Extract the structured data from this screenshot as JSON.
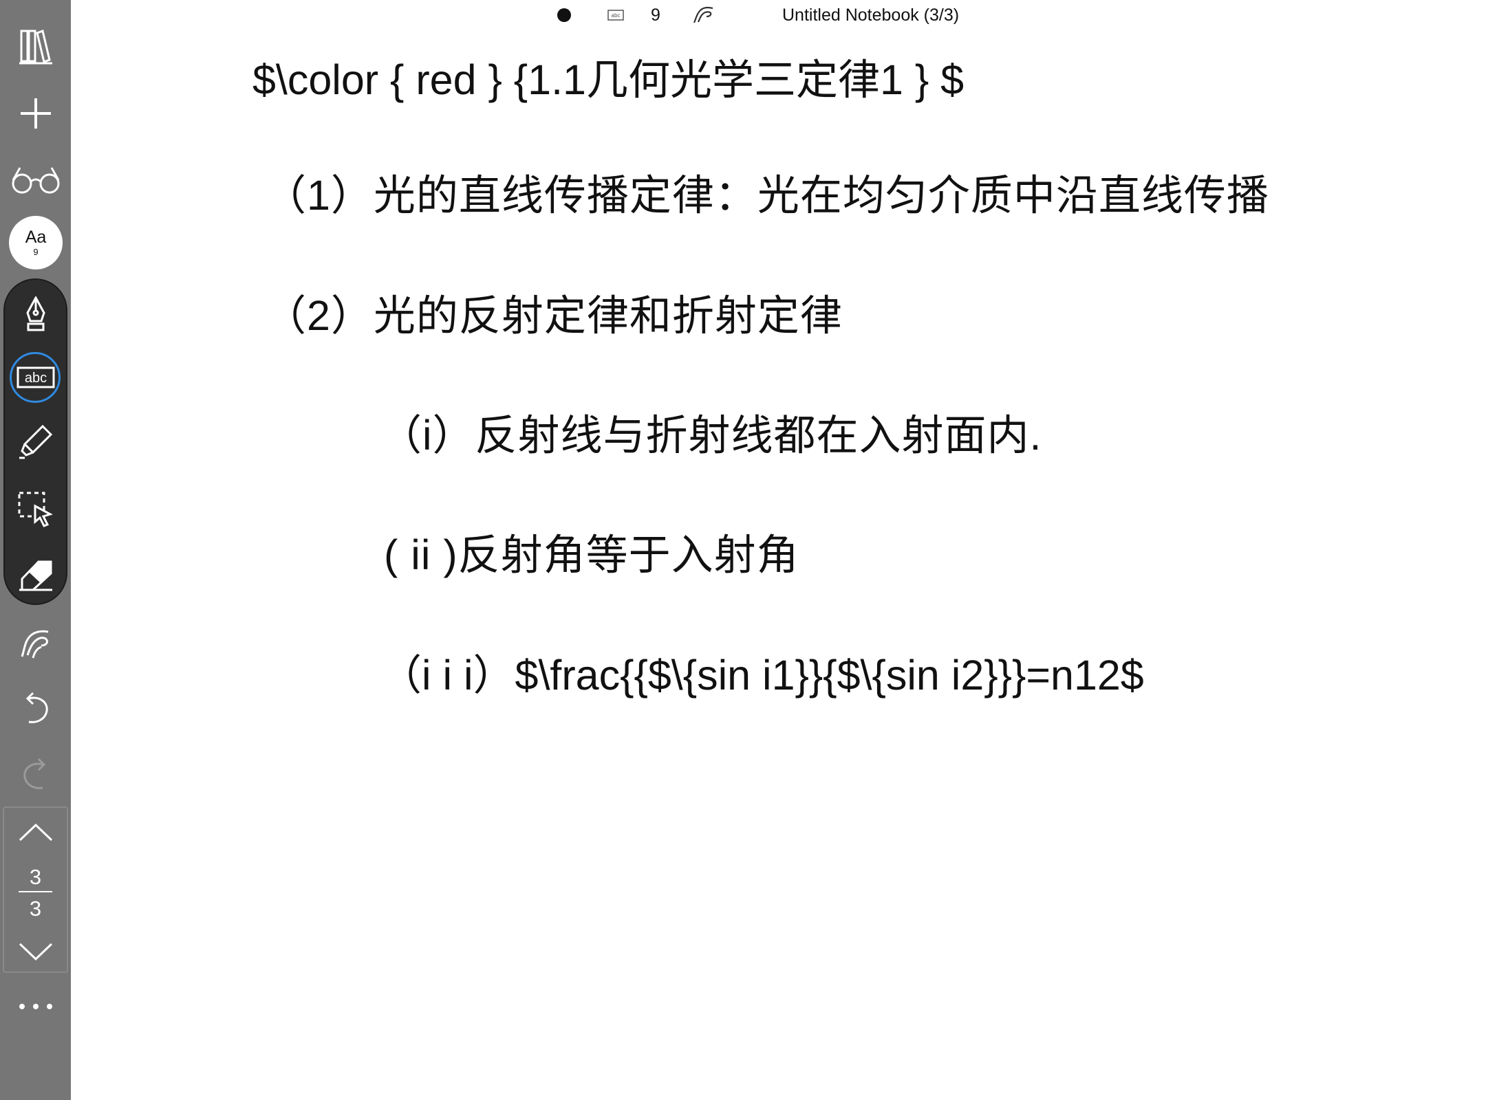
{
  "notebook": {
    "title": "Untitled Notebook (3/3)",
    "stroke_size": "9"
  },
  "sidebar": {
    "items": [
      {
        "name": "library",
        "icon": "library-icon"
      },
      {
        "name": "add",
        "icon": "plus-icon"
      },
      {
        "name": "view",
        "icon": "glasses-icon"
      },
      {
        "name": "font",
        "icon": "font-icon",
        "label": "Aa",
        "size": "9"
      },
      {
        "name": "pen",
        "icon": "fountain-pen-icon"
      },
      {
        "name": "text",
        "icon": "text-box-icon",
        "label": "abc",
        "selected": true
      },
      {
        "name": "highlighter",
        "icon": "highlighter-icon"
      },
      {
        "name": "lasso",
        "icon": "lasso-select-icon"
      },
      {
        "name": "eraser",
        "icon": "eraser-icon"
      },
      {
        "name": "gesture",
        "icon": "hand-gesture-icon"
      },
      {
        "name": "undo",
        "icon": "undo-icon"
      },
      {
        "name": "redo",
        "icon": "redo-icon"
      }
    ],
    "page_current": "3",
    "page_total": "3"
  },
  "content": {
    "lines": [
      "$\\color { red } {1.1几何光学三定律1 } $",
      "（1）光的直线传播定律：光在均匀介质中沿直线传播",
      "（2）光的反射定律和折射定律",
      "（i）反射线与折射线都在入射面内.",
      "( ii )反射角等于入射角",
      "（i i i）$\\frac{{$\\{sin i1}}{$\\{sin i2}}}=n12$"
    ]
  },
  "colors": {
    "sidebar_bg": "#767676",
    "tool_pill_bg": "#2d2d2d",
    "accent_selected": "#2f8ae0",
    "page_bg": "#ffffff"
  }
}
